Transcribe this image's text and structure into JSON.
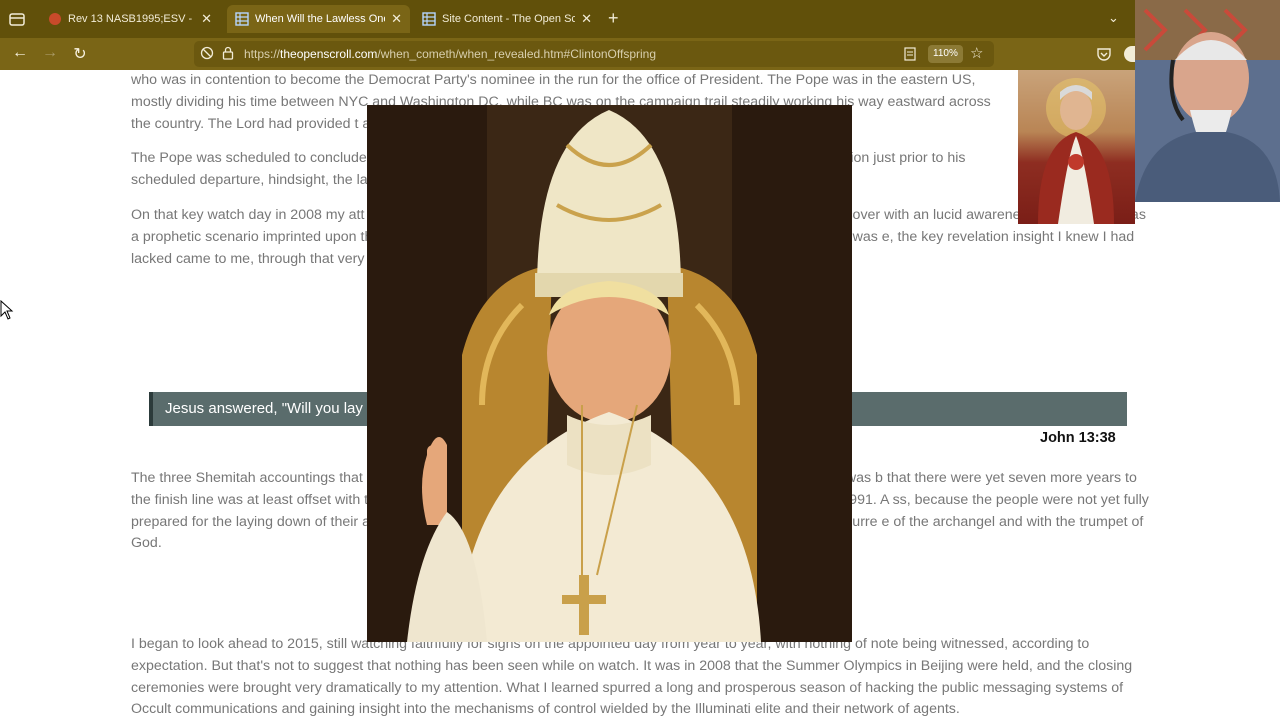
{
  "browser": {
    "tabs": [
      {
        "title": "Rev 13 NASB1995;ESV - The Be",
        "active": false
      },
      {
        "title": "When Will the Lawless One be R",
        "active": true
      },
      {
        "title": "Site Content - The Open Scroll",
        "active": false
      }
    ],
    "url_prefix": "https://",
    "url_domain": "theopenscroll.com",
    "url_path": "/when_cometh/when_revealed.htm#ClintonOffspring",
    "zoom": "110%"
  },
  "article": {
    "p1": "who was in contention to become the Democrat Party's nominee in the run for the office of President. The Pope was in the eastern US, mostly dividing his time between NYC and Washington DC, while BC was on the campaign trail steadily working his way eastward across the country. The Lord had provided t                                                                              and the one who would baptize him.",
    "p2": "The Pope was scheduled to conclude                                                                                   schedule were pretty sketchy, as they had been back in 200                                                                            the Pope's location just prior to his scheduled departure,                                                                         hindsight, the lawless one wasn't revealed, of course, but a",
    "p3": "On that key watch day in 2008 my att                                                                                      ep analysis of the thematic structure. In this rigorous exercise I sought to discover                                                                                with an lucid awareness of how there was a prophetic scenario imprinted upon th                                                                             reports of Bill meeting with the Pope, there was no question where the Lord was                                                                             e, the key revelation insight I knew I had lacked came to me, through that very 13th c",
    "verse_text": "Jesus answered, \"Will you lay                                                                                         ntil you deny Me three times.",
    "verse_ref": "John 13:38",
    "p4": "The three Shemitah accountings that                                                                                        he Lord. The Lord's people, myself included, were not yet ready. The insight was b                                                                            that there were yet seven more years to the finish line was at least offset with the                                                                          of seeking how the Shemitah of fulfillment related to the celestial sign of 1991. A                                                                            ss, because the people were not yet fully prepared for the laying down of their                                                                           at is ripe for harvesting! The rooster crowing describes the wake up call on resurre                                                                          e of the archangel and with the trumpet of God.",
    "p5": "I began to look ahead to 2015, still watching faithfully for signs on the appointed day from year to year, with nothing of note being witnessed, according to expectation. But that's not to suggest that nothing has been seen while on watch. It was in 2008 that the Summer Olympics in Beijing were held, and the closing ceremonies were brought very dramatically to my attention. What I learned spurred a long and prosperous season of hacking the public messaging systems of Occult communications and gaining insight into the mechanisms of control wielded by the Illuminati elite and their network of agents."
  }
}
